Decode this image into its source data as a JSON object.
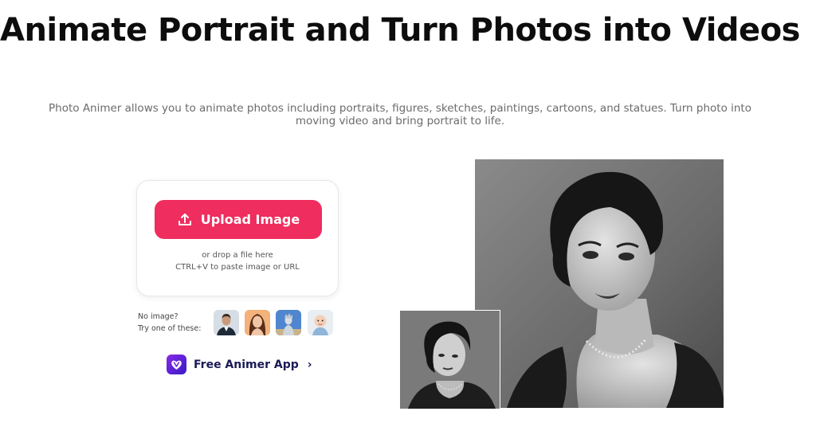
{
  "hero": {
    "title": "Animate Portrait and Turn Photos into Videos",
    "subtitle": "Photo Animer allows you to animate photos including portraits, figures, sketches, paintings, cartoons, and statues. Turn photo into moving video and bring portrait to life."
  },
  "upload": {
    "button_label": "Upload Image",
    "button_icon": "upload-icon",
    "drop_hint": "or drop a file here",
    "paste_hint": "CTRL+V to paste image or URL",
    "accent_color": "#ef2d5e"
  },
  "samples": {
    "label_line1": "No image?",
    "label_line2": "Try one of these:",
    "items": [
      "sample-man-portrait",
      "sample-woman-portrait",
      "sample-statue",
      "sample-baby-portrait"
    ]
  },
  "app_link": {
    "label": "Free Animer App",
    "chevron": "›",
    "icon": "animer-app-icon"
  },
  "preview": {
    "main_image": "black-and-white-woman-portrait",
    "inset_image": "black-and-white-woman-portrait-original"
  }
}
